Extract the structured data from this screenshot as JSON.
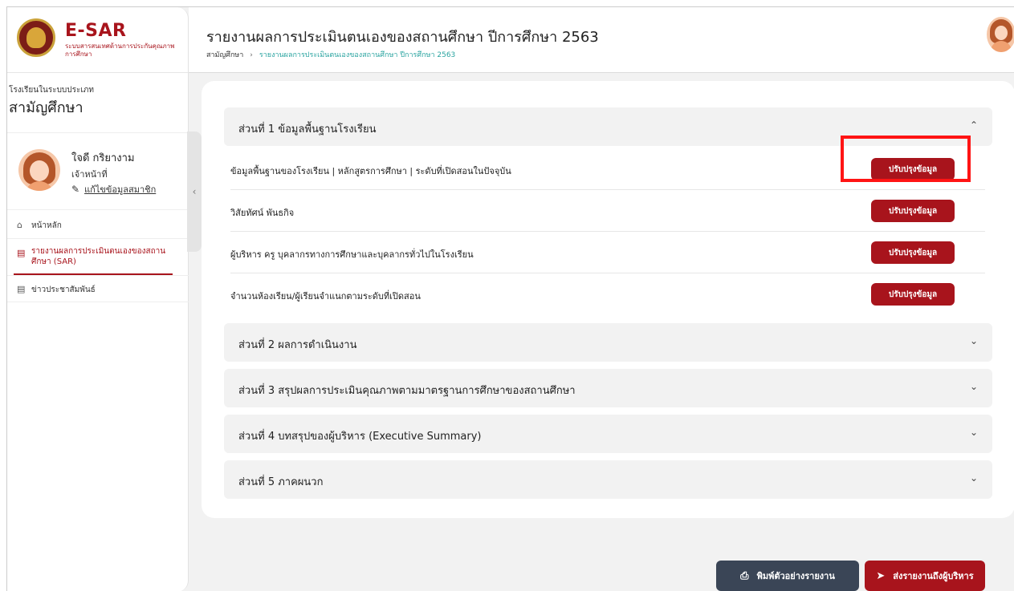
{
  "brand": {
    "title": "E-SAR",
    "subtitle": "ระบบสารสนเทศด้านการประกันคุณภาพการศึกษา"
  },
  "sidebar": {
    "school_type_label": "โรงเรียนในระบบประเภท",
    "school_type": "สามัญศึกษา",
    "user": {
      "name": "ใจดี กริยางาม",
      "role": "เจ้าหน้าที่",
      "edit_link": "แก้ไขข้อมูลสมาชิก"
    },
    "nav": [
      {
        "label": "หน้าหลัก",
        "icon": "home-icon"
      },
      {
        "label": "รายงานผลการประเมินตนเองของสถานศึกษา (SAR)",
        "icon": "document-icon",
        "active": true
      },
      {
        "label": "ข่าวประชาสัมพันธ์",
        "icon": "document-icon"
      }
    ]
  },
  "header": {
    "title": "รายงานผลการประเมินตนเองของสถานศึกษา ปีการศึกษา 2563",
    "breadcrumb": [
      "สามัญศึกษา",
      "รายงานผลการประเมินตนเองของสถานศึกษา ปีการศึกษา 2563"
    ]
  },
  "sections": [
    {
      "label": "ส่วนที่ 1 ข้อมูลพื้นฐานโรงเรียน",
      "expanded": true,
      "items": [
        {
          "label": "ข้อมูลพื้นฐานของโรงเรียน | หลักสูตรการศึกษา | ระดับที่เปิดสอนในปัจจุบัน",
          "button": "ปรับปรุงข้อมูล"
        },
        {
          "label": "วิสัยทัศน์ พันธกิจ",
          "button": "ปรับปรุงข้อมูล"
        },
        {
          "label": "ผู้บริหาร ครู บุคลากรทางการศึกษาและบุคลากรทั่วไปในโรงเรียน",
          "button": "ปรับปรุงข้อมูล"
        },
        {
          "label": "จำนวนห้องเรียน/ผู้เรียนจำแนกตามระดับที่เปิดสอน",
          "button": "ปรับปรุงข้อมูล"
        }
      ]
    },
    {
      "label": "ส่วนที่ 2 ผลการดำเนินงาน",
      "expanded": false
    },
    {
      "label": "ส่วนที่ 3 สรุปผลการประเมินคุณภาพตามมาตรฐานการศึกษาของสถานศึกษา",
      "expanded": false
    },
    {
      "label": "ส่วนที่ 4 บทสรุปของผู้บริหาร (Executive Summary)",
      "expanded": false
    },
    {
      "label": "ส่วนที่ 5 ภาคผนวก",
      "expanded": false
    }
  ],
  "footer": {
    "print_button": "พิมพ์ตัวอย่างรายงาน",
    "send_button": "ส่งรายงานถึงผู้บริหาร"
  },
  "colors": {
    "brand_red": "#a8141c",
    "dark_button": "#3a4556",
    "breadcrumb_current": "#2aa4a0",
    "highlight": "#ff1414"
  }
}
